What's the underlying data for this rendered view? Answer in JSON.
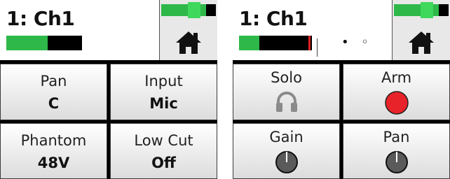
{
  "screens": [
    {
      "title": "1: Ch1",
      "level_meter": {
        "level": 0.55,
        "peak": false
      },
      "home_bar_level": 0.82,
      "home_icon": "home-icon",
      "controls": [
        {
          "label": "Pan",
          "value": "C"
        },
        {
          "label": "Input",
          "value": "Mic"
        },
        {
          "label": "Phantom",
          "value": "48V"
        },
        {
          "label": "Low Cut",
          "value": "Off"
        }
      ]
    },
    {
      "title": "1: Ch1",
      "level_meter": {
        "level": 0.28,
        "peak": true
      },
      "home_bar_level": 0.82,
      "home_icon": "home-icon",
      "page_indicator": "• ◦",
      "controls": [
        {
          "label": "Solo",
          "icon": "headphones-icon"
        },
        {
          "label": "Arm",
          "icon": "record-arm-icon",
          "state": "on"
        },
        {
          "label": "Gain",
          "icon": "knob-icon"
        },
        {
          "label": "Pan",
          "icon": "knob-icon"
        }
      ]
    }
  ],
  "colors": {
    "meter_green": "#2fb84a",
    "peak_red": "#e02020",
    "arm_red": "#e8232a",
    "knob_gray": "#5a5a5a",
    "headphone_gray": "#8a8a8a"
  }
}
